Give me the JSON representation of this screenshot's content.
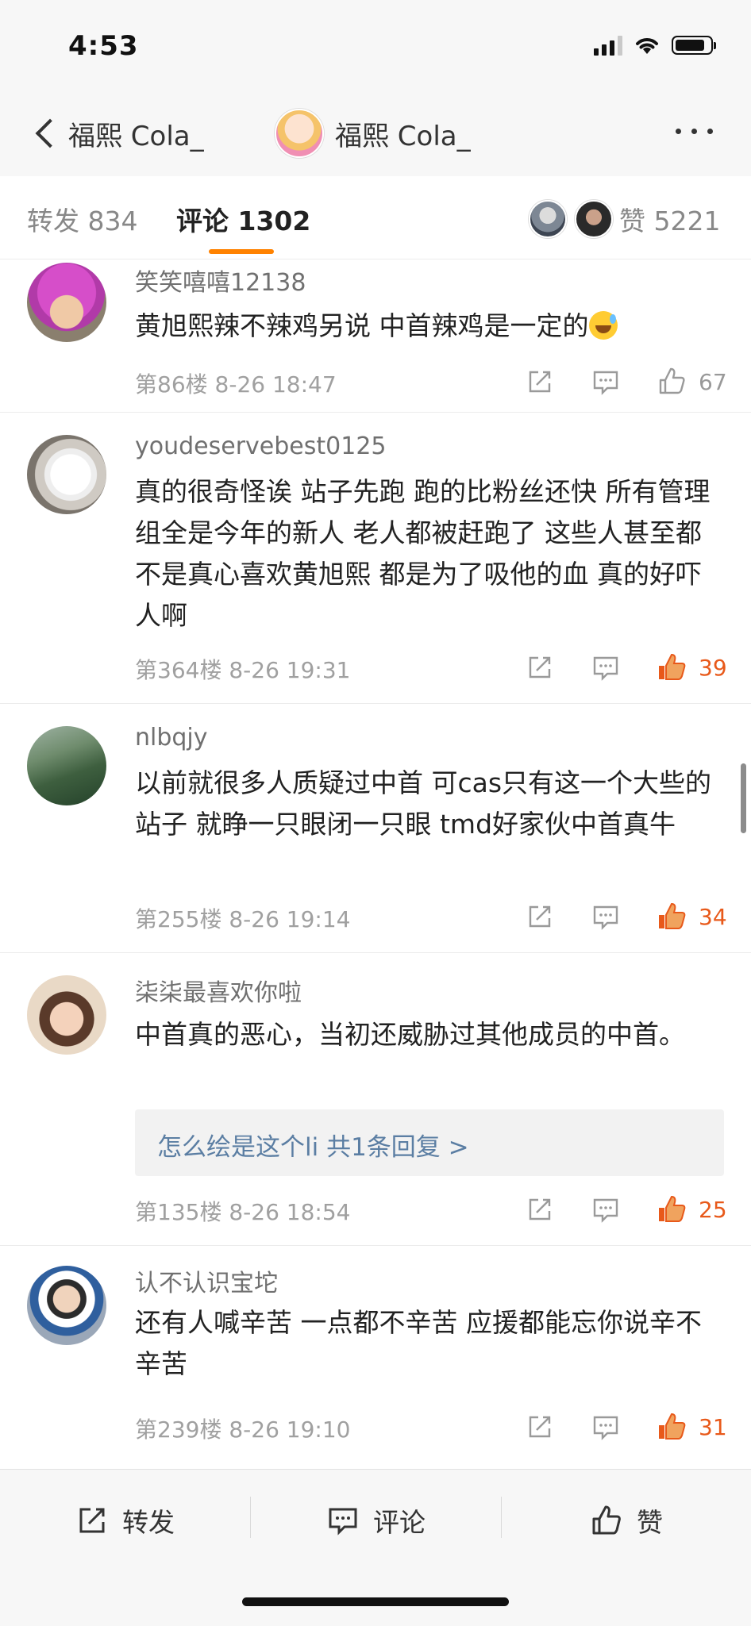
{
  "status_bar": {
    "time": "4:53"
  },
  "nav": {
    "back_label": "福熙 Cola_",
    "title": "福熙 Cola_",
    "more_icon": "more-icon"
  },
  "tabs": {
    "repost": "转发 834",
    "comments": "评论 1302",
    "likes": "赞 5221"
  },
  "comments": [
    {
      "username": "笑笑嘻嘻12138",
      "text": "黄旭熙辣不辣鸡另说 中首辣鸡是一定的",
      "emoji": "sweat-smile-emoji",
      "meta": "第86楼 8-26 18:47",
      "likes": "67",
      "liked": false
    },
    {
      "username": "youdeservebest0125",
      "text": "真的很奇怪诶 站子先跑 跑的比粉丝还快 所有管理组全是今年的新人 老人都被赶跑了 这些人甚至都不是真心喜欢黄旭熙 都是为了吸他的血 真的好吓人啊",
      "meta": "第364楼 8-26 19:31",
      "likes": "39",
      "liked": true
    },
    {
      "username": "nlbqjy",
      "text": "以前就很多人质疑过中首 可cas只有这一个大些的站子 就睁一只眼闭一只眼 tmd好家伙中首真牛",
      "meta": "第255楼 8-26 19:14",
      "likes": "34",
      "liked": true
    },
    {
      "username": "柒柒最喜欢你啦",
      "text": "中首真的恶心，当初还威胁过其他成员的中首。",
      "reply_preview": "怎么绘是这个li  共1条回复 >",
      "meta": "第135楼 8-26 18:54",
      "likes": "25",
      "liked": true
    },
    {
      "username": "认不认识宝坨",
      "text": "还有人喊辛苦  一点都不辛苦  应援都能忘你说辛不辛苦",
      "meta": "第239楼 8-26 19:10",
      "likes": "31",
      "liked": true
    }
  ],
  "bottom_bar": {
    "repost": "转发",
    "comment": "评论",
    "like": "赞"
  },
  "colors": {
    "accent": "#ff8200",
    "liked": "#e8591a",
    "link": "#5b7ea3"
  }
}
